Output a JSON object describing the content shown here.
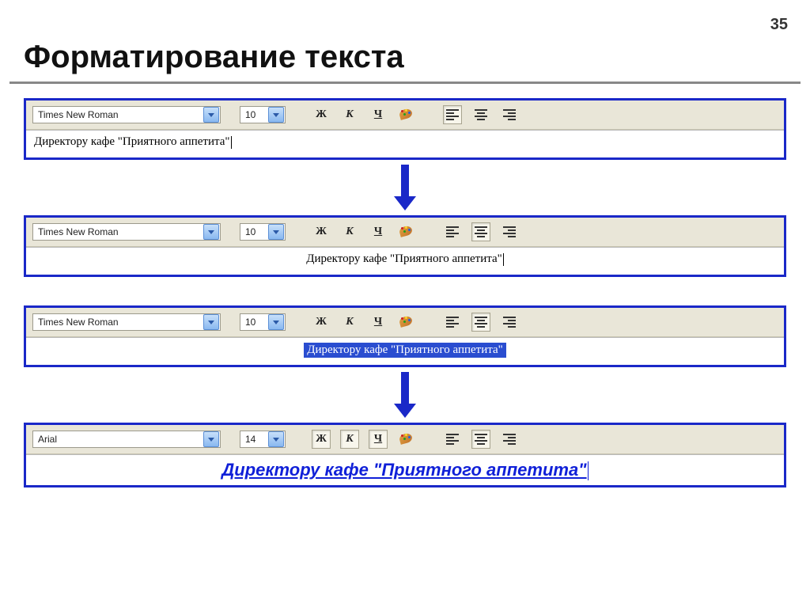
{
  "page_number": "35",
  "title": "Форматирование текста",
  "panels": [
    {
      "font": "Times New Roman",
      "size": "10",
      "bold_label": "Ж",
      "italic_label": "К",
      "underline_label": "Ч",
      "pressed": {
        "bold": false,
        "italic": false,
        "underline": false,
        "align": "left"
      },
      "text_class": "sample1",
      "text": "Директору кафе \"Приятного аппетита\"",
      "show_cursor": true
    },
    {
      "font": "Times New Roman",
      "size": "10",
      "bold_label": "Ж",
      "italic_label": "К",
      "underline_label": "Ч",
      "pressed": {
        "bold": false,
        "italic": false,
        "underline": false,
        "align": "center"
      },
      "text_class": "sample2",
      "text": "Директору кафе \"Приятного аппетита\"",
      "show_cursor": true
    },
    {
      "font": "Times New Roman",
      "size": "10",
      "bold_label": "Ж",
      "italic_label": "К",
      "underline_label": "Ч",
      "pressed": {
        "bold": false,
        "italic": false,
        "underline": false,
        "align": "center"
      },
      "text_class": "sample3",
      "selected": true,
      "text": "Директору кафе \"Приятного аппетита\"",
      "show_cursor": false
    },
    {
      "font": "Arial",
      "size": "14",
      "bold_label": "Ж",
      "italic_label": "К",
      "underline_label": "Ч",
      "pressed": {
        "bold": true,
        "italic": true,
        "underline": true,
        "align": "center"
      },
      "text_class": "sample4",
      "text": "Директору кафе \"Приятного аппетита\"",
      "show_cursor": true
    }
  ],
  "arrows": [
    {
      "after_panel": 0,
      "shaft_height": 40
    },
    {
      "after_panel": 2,
      "shaft_height": 40
    }
  ]
}
